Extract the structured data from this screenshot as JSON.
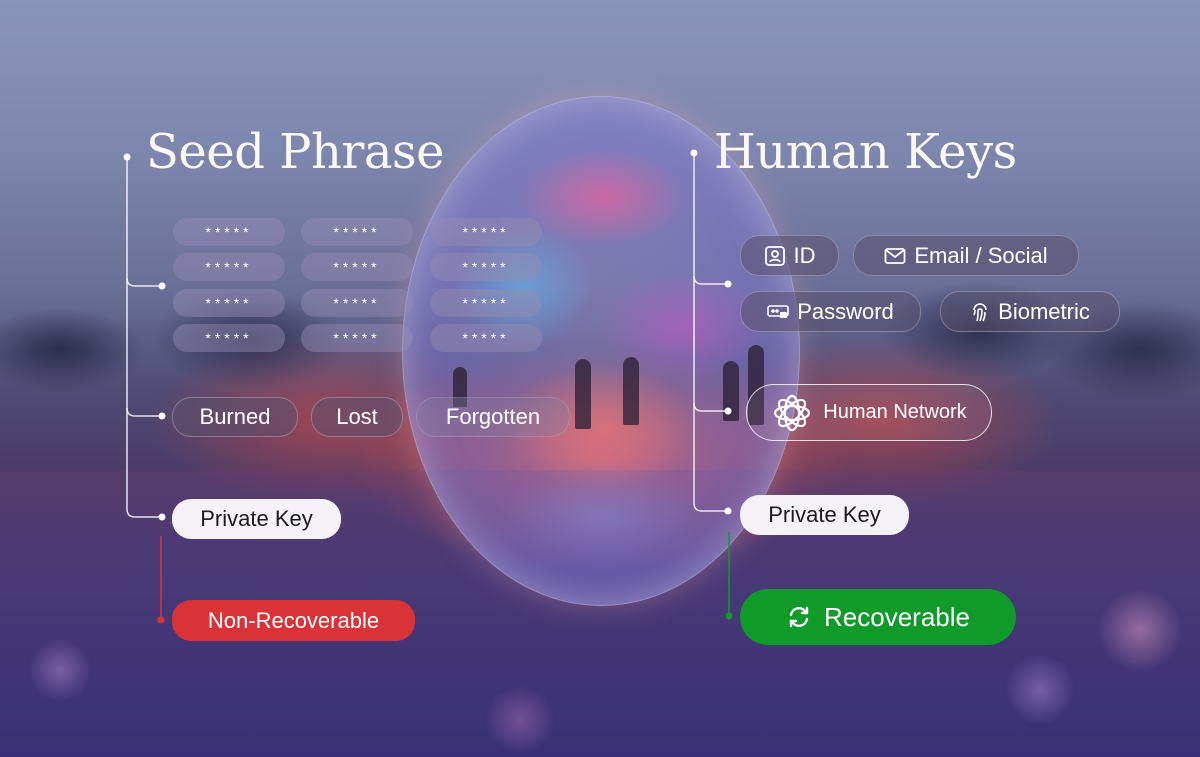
{
  "seed": {
    "title": "Seed Phrase",
    "words": [
      "*****",
      "*****",
      "*****",
      "*****",
      "*****",
      "*****",
      "*****",
      "*****",
      "*****",
      "*****",
      "*****",
      "*****"
    ],
    "loss_reasons": [
      "Burned",
      "Lost",
      "Forgotten"
    ],
    "private_key": "Private Key",
    "result": "Non-Recoverable"
  },
  "human": {
    "title": "Human Keys",
    "factors": [
      "ID",
      "Email / Social",
      "Password",
      "Biometric"
    ],
    "network": "Human Network",
    "private_key": "Private Key",
    "result": "Recoverable"
  },
  "colors": {
    "red": "#d93338",
    "green": "#0f9a2a"
  }
}
